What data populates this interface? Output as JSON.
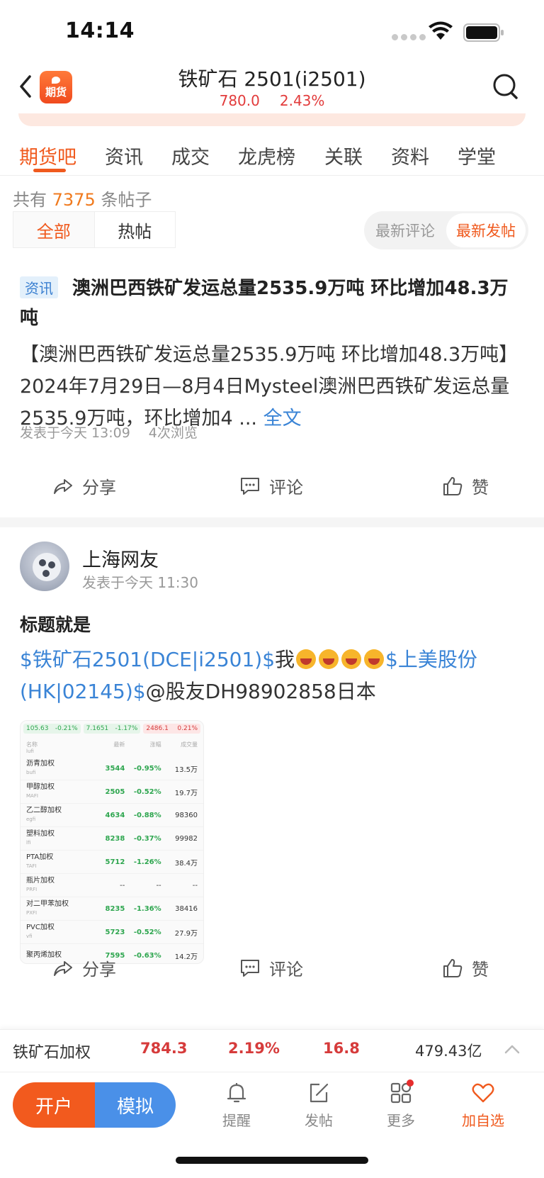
{
  "status_bar": {
    "time": "14:14"
  },
  "header": {
    "app_logo_text": "期货",
    "title": "铁矿石 2501(i2501)",
    "price": "780.0",
    "change_pct": "2.43%"
  },
  "tabs": [
    "期货吧",
    "资讯",
    "成交",
    "龙虎榜",
    "关联",
    "资料",
    "学堂"
  ],
  "post_count": {
    "prefix": "共有",
    "count": "7375",
    "suffix": "条帖子"
  },
  "filter": {
    "all": "全部",
    "hot": "热帖"
  },
  "sort": {
    "latest_comment": "最新评论",
    "latest_post": "最新发帖"
  },
  "post1": {
    "tag": "资讯",
    "title": "澳洲巴西铁矿发运总量2535.9万吨 环比增加48.3万吨",
    "body": "【澳洲巴西铁矿发运总量2535.9万吨 环比增加48.3万吨】2024年7月29日—8月4日Mysteel澳洲巴西铁矿发运总量2535.9万吨，环比增加4 ...",
    "full_text": "全文",
    "posted": "发表于今天 13:09",
    "views": "4次浏览"
  },
  "actions": {
    "share": "分享",
    "comment": "评论",
    "like": "赞"
  },
  "post2": {
    "author": "上海网友",
    "posted": "发表于今天 11:30",
    "title": "标题就是",
    "link1": "$铁矿石2501(DCE|i2501)$",
    "text1": "我",
    "link2": "$上美股份(HK|02145)$",
    "text2": "@股友DH98902858日本"
  },
  "thumbnail": {
    "top": [
      {
        "value": "105.63",
        "change": "-0.21%"
      },
      {
        "value": "7.1651",
        "change": "-1.17%"
      },
      {
        "value": "2486.1",
        "change": "0.21%"
      }
    ],
    "headers": [
      "名称",
      "最新",
      "涨幅",
      "成交量"
    ],
    "first_code": "lufi",
    "rows": [
      {
        "name": "沥青加权",
        "code": "bufi",
        "last": "3544",
        "chg": "-0.95%",
        "vol": "13.5万"
      },
      {
        "name": "甲醇加权",
        "code": "MAFI",
        "last": "2505",
        "chg": "-0.52%",
        "vol": "19.7万"
      },
      {
        "name": "乙二醇加权",
        "code": "egfi",
        "last": "4634",
        "chg": "-0.88%",
        "vol": "98360"
      },
      {
        "name": "塑料加权",
        "code": "lfi",
        "last": "8238",
        "chg": "-0.37%",
        "vol": "99982"
      },
      {
        "name": "PTA加权",
        "code": "TAFI",
        "last": "5712",
        "chg": "-1.26%",
        "vol": "38.4万"
      },
      {
        "name": "瓶片加权",
        "code": "PRFI",
        "last": "--",
        "chg": "--",
        "vol": "--"
      },
      {
        "name": "对二甲苯加权",
        "code": "PXFI",
        "last": "8235",
        "chg": "-1.36%",
        "vol": "38416"
      },
      {
        "name": "PVC加权",
        "code": "vfi",
        "last": "5723",
        "chg": "-0.52%",
        "vol": "27.9万"
      },
      {
        "name": "聚丙烯加权",
        "code": "",
        "last": "7595",
        "chg": "-0.63%",
        "vol": "14.2万"
      }
    ]
  },
  "ticker": {
    "name": "铁矿石加权",
    "price": "784.3",
    "change_pct": "2.19%",
    "change": "16.8",
    "volume": "479.43亿"
  },
  "bottom_bar": {
    "open_account": "开户",
    "simulate": "模拟",
    "items": [
      "提醒",
      "发帖",
      "更多",
      "加自选"
    ]
  },
  "colors": {
    "accent": "#f05a1e",
    "up": "#d63b3b",
    "link": "#3a84d6",
    "down": "#2ea64f"
  }
}
